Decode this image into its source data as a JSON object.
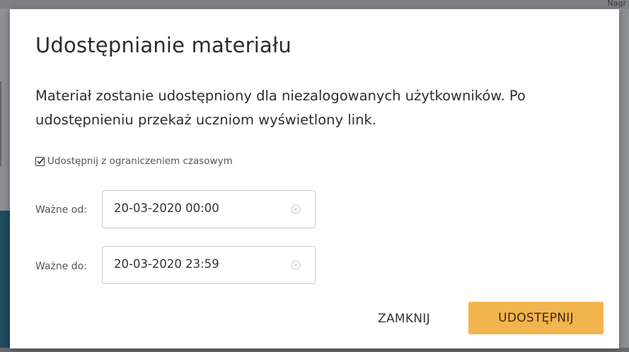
{
  "background": {
    "top_right_text": "Nagr"
  },
  "modal": {
    "title": "Udostępnianie materiału",
    "description": "Materiał zostanie udostępniony dla niezalogowanych użytkowników. Po udostępnieniu przekaż uczniom wyświetlony link.",
    "time_limit_checkbox": {
      "label": "Udostępnij z ograniczeniem czasowym",
      "checked": true
    },
    "valid_from": {
      "label": "Ważne od:",
      "value": "20-03-2020 00:00"
    },
    "valid_to": {
      "label": "Ważne do:",
      "value": "20-03-2020 23:59"
    },
    "close_button_label": "ZAMKNIJ",
    "share_button_label": "UDOSTĘPNIJ"
  },
  "colors": {
    "accent": "#f2b44f",
    "overlay": "#8e9093",
    "background_teal": "#1f4c5e"
  },
  "icons": [
    "checkbox-checked-icon",
    "clear-icon"
  ]
}
